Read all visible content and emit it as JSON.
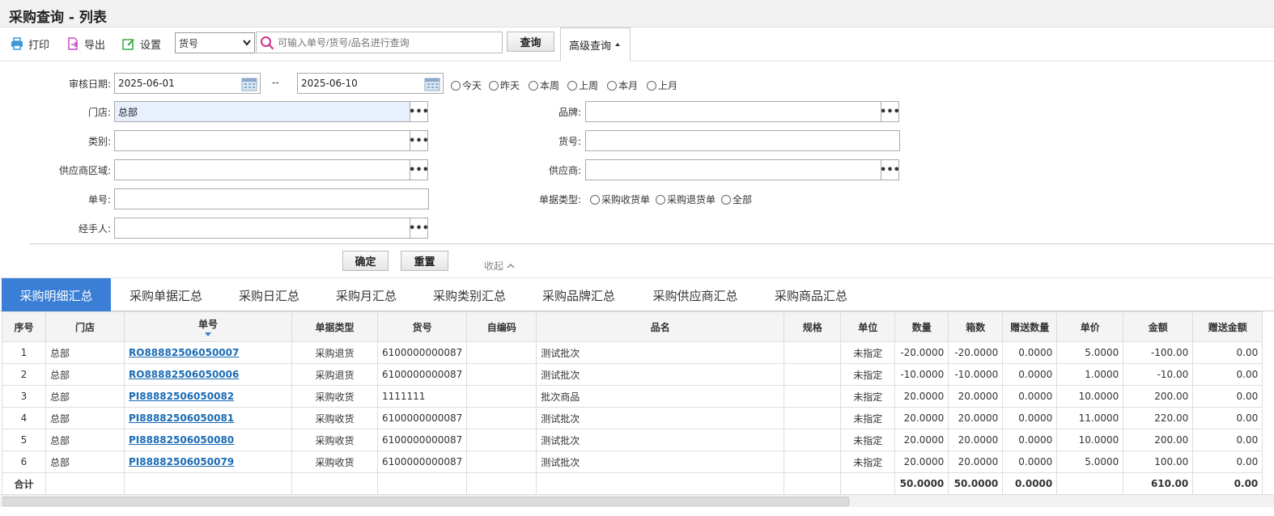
{
  "page_title": "采购查询 - 列表",
  "toolbar": {
    "print_label": "打印",
    "export_label": "导出",
    "settings_label": "设置",
    "field_select": "货号",
    "search_placeholder": "可输入单号/货号/品名进行查询",
    "query_label": "查询",
    "advanced_label": "高级查询"
  },
  "filters": {
    "audit_date_label": "审核日期:",
    "date_from": "2025-06-01",
    "date_sep": "--",
    "date_to": "2025-06-10",
    "quick_dates": [
      "今天",
      "昨天",
      "本周",
      "上周",
      "本月",
      "上月"
    ],
    "store_label": "门店:",
    "store_value": "总部",
    "brand_label": "品牌:",
    "category_label": "类别:",
    "item_no_label": "货号:",
    "supplier_region_label": "供应商区域:",
    "supplier_label": "供应商:",
    "doc_no_label": "单号:",
    "doc_type_label": "单据类型:",
    "doc_types": [
      "采购收货单",
      "采购退货单",
      "全部"
    ],
    "handler_label": "经手人:",
    "confirm_label": "确定",
    "reset_label": "重置",
    "collapse_label": "收起"
  },
  "tabs": [
    "采购明细汇总",
    "采购单据汇总",
    "采购日汇总",
    "采购月汇总",
    "采购类别汇总",
    "采购品牌汇总",
    "采购供应商汇总",
    "采购商品汇总"
  ],
  "table": {
    "headers": [
      "序号",
      "门店",
      "单号",
      "单据类型",
      "货号",
      "自编码",
      "品名",
      "规格",
      "单位",
      "数量",
      "箱数",
      "赠送数量",
      "单价",
      "金额",
      "赠送金额"
    ],
    "rows": [
      [
        "1",
        "总部",
        "RO88882506050007",
        "采购退货",
        "6100000000087",
        "",
        "测试批次",
        "",
        "未指定",
        "-20.0000",
        "-20.0000",
        "0.0000",
        "5.0000",
        "-100.00",
        "0.00"
      ],
      [
        "2",
        "总部",
        "RO88882506050006",
        "采购退货",
        "6100000000087",
        "",
        "测试批次",
        "",
        "未指定",
        "-10.0000",
        "-10.0000",
        "0.0000",
        "1.0000",
        "-10.00",
        "0.00"
      ],
      [
        "3",
        "总部",
        "PI88882506050082",
        "采购收货",
        "1111111",
        "",
        "批次商品",
        "",
        "未指定",
        "20.0000",
        "20.0000",
        "0.0000",
        "10.0000",
        "200.00",
        "0.00"
      ],
      [
        "4",
        "总部",
        "PI88882506050081",
        "采购收货",
        "6100000000087",
        "",
        "测试批次",
        "",
        "未指定",
        "20.0000",
        "20.0000",
        "0.0000",
        "11.0000",
        "220.00",
        "0.00"
      ],
      [
        "5",
        "总部",
        "PI88882506050080",
        "采购收货",
        "6100000000087",
        "",
        "测试批次",
        "",
        "未指定",
        "20.0000",
        "20.0000",
        "0.0000",
        "10.0000",
        "200.00",
        "0.00"
      ],
      [
        "6",
        "总部",
        "PI88882506050079",
        "采购收货",
        "6100000000087",
        "",
        "测试批次",
        "",
        "未指定",
        "20.0000",
        "20.0000",
        "0.0000",
        "5.0000",
        "100.00",
        "0.00"
      ]
    ],
    "total": [
      "合计",
      "",
      "",
      "",
      "",
      "",
      "",
      "",
      "",
      "50.0000",
      "50.0000",
      "0.0000",
      "",
      "610.00",
      "0.00"
    ]
  }
}
